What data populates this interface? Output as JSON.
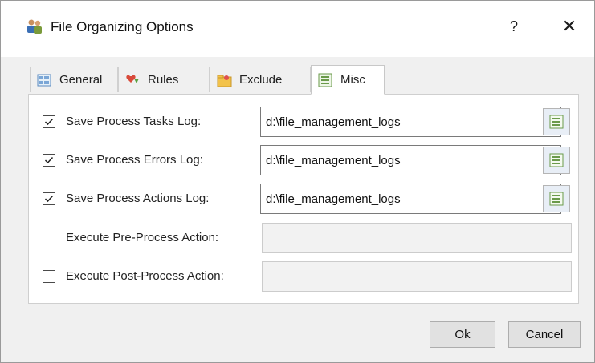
{
  "window": {
    "title": "File Organizing Options",
    "help_label": "?",
    "close_label": "✕"
  },
  "tabs": [
    {
      "label": "General",
      "icon": "general-grid-icon",
      "active": false
    },
    {
      "label": "Rules",
      "icon": "rules-heart-icon",
      "active": false
    },
    {
      "label": "Exclude",
      "icon": "exclude-folder-icon",
      "active": false
    },
    {
      "label": "Misc",
      "icon": "misc-list-icon",
      "active": true
    }
  ],
  "rows": [
    {
      "label": "Save Process Tasks Log:",
      "checked": true,
      "value": "d:\\file_management_logs",
      "enabled": true,
      "browse_icon": "list-icon"
    },
    {
      "label": "Save Process Errors Log:",
      "checked": true,
      "value": "d:\\file_management_logs",
      "enabled": true,
      "browse_icon": "list-icon"
    },
    {
      "label": "Save Process Actions Log:",
      "checked": true,
      "value": "d:\\file_management_logs",
      "enabled": true,
      "browse_icon": "list-icon"
    },
    {
      "label": "Execute Pre-Process Action:",
      "checked": false,
      "value": "",
      "enabled": false
    },
    {
      "label": "Execute Post-Process Action:",
      "checked": false,
      "value": "",
      "enabled": false
    }
  ],
  "buttons": {
    "ok_label": "Ok",
    "cancel_label": "Cancel"
  },
  "colors": {
    "accent": "#4a8a2a",
    "icon_blue": "#6a9ad0"
  }
}
